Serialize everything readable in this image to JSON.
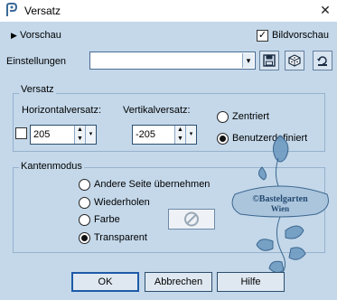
{
  "window": {
    "title": "Versatz",
    "close_glyph": "✕"
  },
  "preview": {
    "label": "Vorschau",
    "arrow_glyph": "▶",
    "image_preview_label": "Bildvorschau",
    "image_preview_checked": true,
    "check_glyph": "✓"
  },
  "settings": {
    "label": "Einstellungen",
    "preset_value": "",
    "dropdown_glyph": "▾"
  },
  "offset_group": {
    "label": "Versatz",
    "horizontal_label": "Horizontalversatz:",
    "horizontal_value": "205",
    "vertical_label": "Vertikalversatz:",
    "vertical_value": "-205",
    "link_checked": false,
    "spin_up_glyph": "▲",
    "spin_down_glyph": "▼",
    "drop_glyph": "▾",
    "centered_label": "Zentriert",
    "custom_label": "Benutzerdefiniert",
    "selected": "custom"
  },
  "edge_group": {
    "label": "Kantenmodus",
    "options": [
      {
        "label": "Andere Seite übernehmen",
        "selected": false
      },
      {
        "label": "Wiederholen",
        "selected": false
      },
      {
        "label": "Farbe",
        "selected": false
      },
      {
        "label": "Transparent",
        "selected": true
      }
    ]
  },
  "watermark": {
    "line1": "©Bastelgarten",
    "line2": "Wien"
  },
  "buttons": {
    "ok": "OK",
    "cancel": "Abbrechen",
    "help": "Hilfe"
  },
  "colors": {
    "background": "#c4d8ea",
    "accent": "#1e5ba8"
  }
}
